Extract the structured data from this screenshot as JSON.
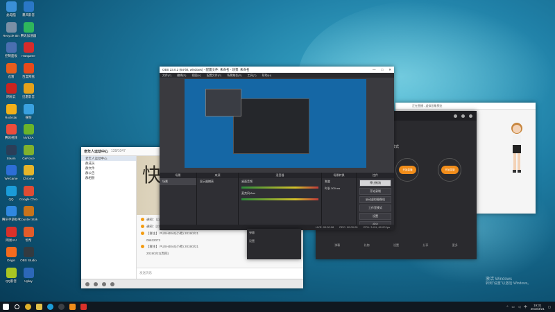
{
  "desktop": {
    "icons": [
      {
        "label": "此电脑",
        "color": "#3a8fd6"
      },
      {
        "label": "暴风影音",
        "color": "#2a77c6"
      },
      {
        "label": "Recycle Bin",
        "color": "#7a8fa5"
      },
      {
        "label": "腾讯加速器",
        "color": "#2fb65c"
      },
      {
        "label": "控制面板",
        "color": "#4a6fb0"
      },
      {
        "label": "Hangame",
        "color": "#d62b2b"
      },
      {
        "label": "迅雷",
        "color": "#e85d1d"
      },
      {
        "label": "百度网盘",
        "color": "#e84a1a"
      },
      {
        "label": "网易云",
        "color": "#c9241f"
      },
      {
        "label": "迅雷影音",
        "color": "#e5a11a"
      },
      {
        "label": "Rockstar",
        "color": "#f1b01a"
      },
      {
        "label": "搜狗",
        "color": "#3aa1e0"
      },
      {
        "label": "腾讯视频",
        "color": "#ec4d3c"
      },
      {
        "label": "NVIDIA",
        "color": "#6ab42a"
      },
      {
        "label": "Steam",
        "color": "#2a3e58"
      },
      {
        "label": "GeForce",
        "color": "#80b12d"
      },
      {
        "label": "WeGame",
        "color": "#2d6ed6"
      },
      {
        "label": "Chrome",
        "color": "#e6b52a"
      },
      {
        "label": "QQ",
        "color": "#1b9cd8"
      },
      {
        "label": "Google Chrome",
        "color": "#e04c34"
      },
      {
        "label": "腾讯手游助手",
        "color": "#3088e0"
      },
      {
        "label": "Counter Strike",
        "color": "#c8731b"
      },
      {
        "label": "网易UU",
        "color": "#d9312a"
      },
      {
        "label": "帮帮",
        "color": "#e25c2a"
      },
      {
        "label": "Origin",
        "color": "#f56b1e"
      },
      {
        "label": "OBS Studio",
        "color": "#333a40"
      },
      {
        "label": "QQ影音",
        "color": "#a9c523"
      },
      {
        "label": "Uplay",
        "color": "#2c67b8"
      }
    ],
    "watermark": {
      "line1": "激活 Windows",
      "line2": "转到\"设置\"以激活 Windows。"
    }
  },
  "chat_window": {
    "title": "老年人运动中心",
    "group_count": "139/1047",
    "sidebar": [
      "老年人运动中心",
      "群成员",
      "群文件",
      "群公告",
      "群相册"
    ],
    "banner_text": "快乐",
    "messages": [
      "通知：以前的直播可在主播页面查看，直播将持续进行",
      "通知：[13号] 刚刚的直播已经结束，感谢大家的观看",
      "【群主】 PUSH4044(小帅) 2019/3/21",
      "09632073",
      "【群主】 PUSH4044(小帅) 2019/3/21",
      "2019/3/21(周四)"
    ],
    "input_placeholder": "发送消息"
  },
  "obs": {
    "title": "OBS 23.0.2 (64-bit, windows) - 配置文件: 未命名 - 场景: 未命名",
    "menu": [
      "文件(F)",
      "编辑(E)",
      "视图(V)",
      "配置文件(P)",
      "场景集合(S)",
      "工具(T)",
      "帮助(H)"
    ],
    "docks": {
      "scenes": {
        "header": "场景",
        "items": [
          "场景"
        ]
      },
      "sources": {
        "header": "来源",
        "items": [
          "显示器捕获"
        ]
      },
      "mixer": {
        "header": "混音器",
        "tracks": [
          "桌面音频",
          "麦克风/Aux"
        ]
      },
      "transitions": {
        "header": "场景转换",
        "mode": "渐变",
        "duration_label": "时长",
        "duration": "300 ms"
      },
      "controls": {
        "header": "控件",
        "buttons": [
          "停止推流",
          "开始录制",
          "启动虚拟摄像机",
          "工作室模式",
          "设置",
          "退出"
        ],
        "active": 0
      }
    },
    "status": [
      "LIVE: 00:00:08",
      "REC: 00:00:00",
      "CPU: 3.4%, 60.00 fps"
    ]
  },
  "dark_window": {
    "mode_label": "模式",
    "left_button": "开始直播",
    "right_button": "开始录制",
    "bottom_items": [
      "弹幕",
      "礼物",
      "设置",
      "分享",
      "更多"
    ]
  },
  "preview_window": {
    "title": "正在直播 - 虚拟形象预览"
  },
  "taskbar": {
    "time": "19:31",
    "date": "2019/3/21",
    "ime": "中"
  }
}
